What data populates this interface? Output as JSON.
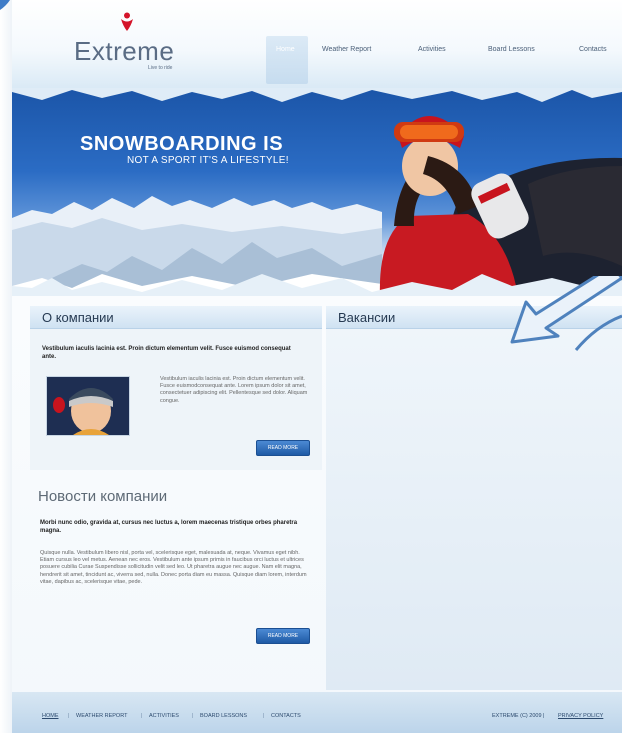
{
  "site": {
    "logo_text": "Extreme",
    "tagline": "Live to ride"
  },
  "nav": {
    "items": [
      {
        "label": "Home"
      },
      {
        "label": "Weather Report"
      },
      {
        "label": "Activities"
      },
      {
        "label": "Board Lessons"
      },
      {
        "label": "Contacts"
      }
    ],
    "active": "Home"
  },
  "hero": {
    "title": "SNOWBOARDING IS",
    "subtitle": "NOT A SPORT IT'S A LIFESTYLE!"
  },
  "about": {
    "heading": "О компании",
    "intro": "Vestibulum iaculis lacinia est. Proin dictum elementum velit. Fusce euismod consequat ante.",
    "body": "Vestibulum iaculis lacinia est. Proin dictum elementum velit. Fusce euismodconsequat ante. Lorem ipsum dolor sit amet, consectetuer adipiscing elit. Pellentesque sed dolor. Aliquam congue.",
    "button": "READ MORE"
  },
  "vacancies": {
    "heading": "Вакансии"
  },
  "news": {
    "heading": "Новости компании",
    "intro": "Morbi nunc odio, gravida at, cursus nec luctus a, lorem maecenas tristique orbes pharetra magna.",
    "body": "Quisque nulla. Vestibulum libero nisl, porta vel, scelerisque eget, malesuada at, neque. Vivamus eget nibh. Etiam cursus leo vel metus. Aenean nec eros. Vestibulum ante ipsum primis in faucibus orci luctus et ultrices posuere cubilia Curae Suspendisse sollicitudin velit sed leo. Ut pharetra augue nec augue. Nam elit magna, hendrerit sit amet, tincidunt ac, viverra sed, nulla. Donec porta diam eu massa. Quisque diam lorem, interdum vitae, dapibus ac, scelerisque vitae, pede.",
    "button": "READ MORE"
  },
  "footer": {
    "links": [
      {
        "label": "HOME"
      },
      {
        "label": "WEATHER REPORT"
      },
      {
        "label": "ACTIVITIES"
      },
      {
        "label": "BOARD LESSONS"
      },
      {
        "label": "CONTACTS"
      }
    ],
    "copyright": "EXTREME (C) 2009 |",
    "privacy": "PRIVACY POLICY"
  },
  "colors": {
    "accent_blue": "#2b6cc4",
    "logo_red": "#d4142a",
    "text_dark": "#263a52"
  }
}
